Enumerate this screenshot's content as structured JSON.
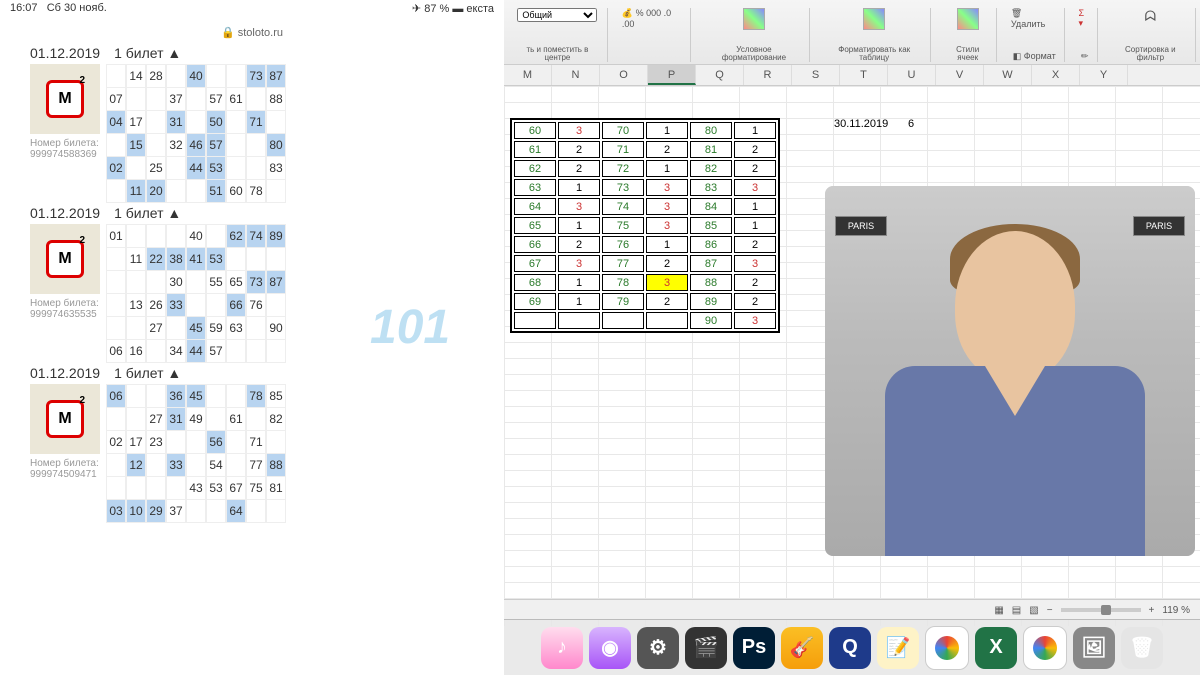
{
  "status": {
    "time": "16:07",
    "date": "Сб 30 нояб.",
    "battery": "87 %",
    "extra": "екста"
  },
  "url": "stoloto.ru",
  "tickets": [
    {
      "date": "01.12.2019",
      "count": "1 билет ▲",
      "label": "Номер билета:",
      "num": "999974588369",
      "rows": [
        [
          "",
          "14",
          "28",
          "",
          "40",
          "",
          "",
          "73",
          "87"
        ],
        [
          "07",
          "",
          "",
          "37",
          "",
          "57",
          "61",
          "",
          "88"
        ],
        [
          "04",
          "17",
          "",
          "31",
          "",
          "50",
          "",
          "71",
          ""
        ],
        [
          "",
          "15",
          "",
          "32",
          "46",
          "57",
          "",
          "",
          "80"
        ],
        [
          "02",
          "",
          "25",
          "",
          "44",
          "53",
          "",
          "",
          "83"
        ],
        [
          "",
          "11",
          "20",
          "",
          "",
          "51",
          "60",
          "78",
          ""
        ]
      ]
    },
    {
      "date": "01.12.2019",
      "count": "1 билет ▲",
      "label": "Номер билета:",
      "num": "999974635535",
      "rows": [
        [
          "01",
          "",
          "",
          "",
          "40",
          "",
          "62",
          "74",
          "89"
        ],
        [
          "",
          "11",
          "22",
          "38",
          "41",
          "53",
          "",
          "",
          ""
        ],
        [
          "",
          "",
          "",
          "30",
          "",
          "55",
          "65",
          "73",
          "87"
        ],
        [
          "",
          "13",
          "26",
          "33",
          "",
          "",
          "66",
          "76",
          ""
        ],
        [
          "",
          "",
          "27",
          "",
          "45",
          "59",
          "63",
          "",
          "90"
        ],
        [
          "06",
          "16",
          "",
          "34",
          "44",
          "57",
          "",
          "",
          ""
        ]
      ]
    },
    {
      "date": "01.12.2019",
      "count": "1 билет ▲",
      "label": "Номер билета:",
      "num": "999974509471",
      "rows": [
        [
          "06",
          "",
          "",
          "36",
          "45",
          "",
          "",
          "78",
          "85"
        ],
        [
          "",
          "",
          "27",
          "31",
          "49",
          "",
          "61",
          "",
          "82"
        ],
        [
          "02",
          "17",
          "23",
          "",
          "",
          "56",
          "",
          "71",
          ""
        ],
        [
          "",
          "12",
          "",
          "33",
          "",
          "54",
          "",
          "77",
          "88"
        ],
        [
          "",
          "",
          "",
          "",
          "43",
          "53",
          "67",
          "75",
          "81"
        ],
        [
          "03",
          "10",
          "29",
          "37",
          "",
          "",
          "64",
          "",
          ""
        ]
      ]
    }
  ],
  "watermark": "101",
  "ribbon": {
    "dropdown": "Общий",
    "merge": "ть и поместить в центре",
    "pct": "%",
    "zeros": "000",
    "cond": "Условное форматирование",
    "fmt_table": "Форматировать как таблицу",
    "styles": "Стили ячеек",
    "delete": "Удалить",
    "format": "Формат",
    "sort": "Сортировка и фильтр"
  },
  "columns": [
    "M",
    "N",
    "O",
    "P",
    "Q",
    "R",
    "S",
    "T",
    "U",
    "V",
    "W",
    "X",
    "Y"
  ],
  "selected_col": "P",
  "cell_date": "30.11.2019",
  "cell_six": "6",
  "data_rows": [
    [
      "60",
      "3",
      "70",
      "1",
      "80",
      "1"
    ],
    [
      "61",
      "2",
      "71",
      "2",
      "81",
      "2"
    ],
    [
      "62",
      "2",
      "72",
      "1",
      "82",
      "2"
    ],
    [
      "63",
      "1",
      "73",
      "3",
      "83",
      "3"
    ],
    [
      "64",
      "3",
      "74",
      "3",
      "84",
      "1"
    ],
    [
      "65",
      "1",
      "75",
      "3",
      "85",
      "1"
    ],
    [
      "66",
      "2",
      "76",
      "1",
      "86",
      "2"
    ],
    [
      "67",
      "3",
      "77",
      "2",
      "87",
      "3"
    ],
    [
      "68",
      "1",
      "78",
      "3",
      "88",
      "2"
    ],
    [
      "69",
      "1",
      "79",
      "2",
      "89",
      "2"
    ],
    [
      "",
      "",
      "",
      "",
      "90",
      "3"
    ]
  ],
  "highlight_row": 8,
  "highlight_col": 3,
  "paris": "PARIS",
  "footer_zoom": "119 %",
  "dock_items": [
    {
      "bg": "linear-gradient(#fde,#f8c)",
      "txt": "♪"
    },
    {
      "bg": "linear-gradient(#d8b4fe,#a855f7)",
      "txt": "◉"
    },
    {
      "bg": "#555",
      "txt": "⚙"
    },
    {
      "bg": "#333",
      "txt": "🎬"
    },
    {
      "bg": "#001e36",
      "txt": "Ps"
    },
    {
      "bg": "linear-gradient(#fbbf24,#f59e0b)",
      "txt": "🎸"
    },
    {
      "bg": "#1e3a8a",
      "txt": "Q"
    },
    {
      "bg": "#fef3c7",
      "txt": "📝"
    },
    {
      "bg": "#fff",
      "txt": ""
    },
    {
      "bg": "#217346",
      "txt": "X"
    },
    {
      "bg": "#fff",
      "txt": ""
    },
    {
      "bg": "#888",
      "txt": "🖼"
    },
    {
      "bg": "#e5e5e5",
      "txt": "🗑"
    }
  ]
}
